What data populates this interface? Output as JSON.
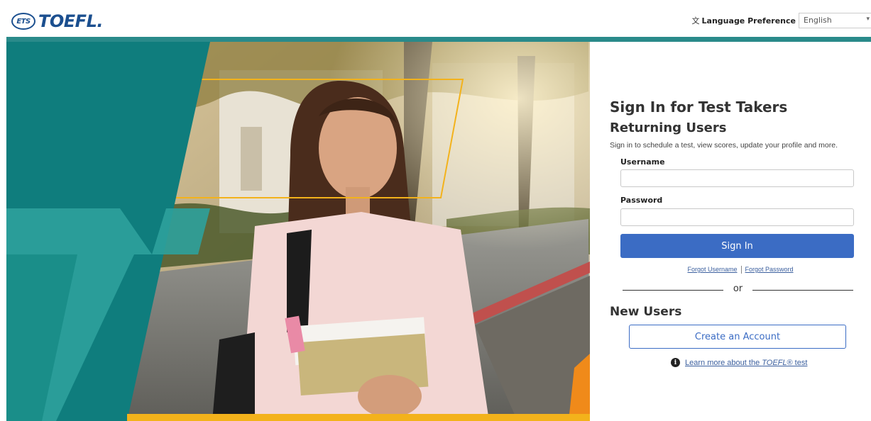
{
  "header": {
    "logo_badge": "ETS",
    "logo_text": "TOEFL.",
    "language_icon": "translate-icon",
    "language_label": "Language Preference",
    "language_value": "English"
  },
  "hero": {
    "image": "photo-student-holding-books",
    "colors": {
      "teal": "#0f7d7d",
      "yellow": "#f3b21b"
    }
  },
  "signin": {
    "title": "Sign In for Test Takers",
    "subtitle": "Returning Users",
    "intro": "Sign in to schedule a test, view scores, update your profile and more.",
    "username_label": "Username",
    "username_value": "",
    "password_label": "Password",
    "password_value": "",
    "signin_button": "Sign In",
    "forgot_username": "Forgot Username",
    "forgot_password": "Forgot Password",
    "or": "or",
    "new_users_heading": "New Users",
    "create_account_button": "Create an Account",
    "learn_more_prefix": "Learn more about the ",
    "learn_more_em": "TOEFL",
    "learn_more_suffix": "® test",
    "accent": "#3b6cc4"
  }
}
